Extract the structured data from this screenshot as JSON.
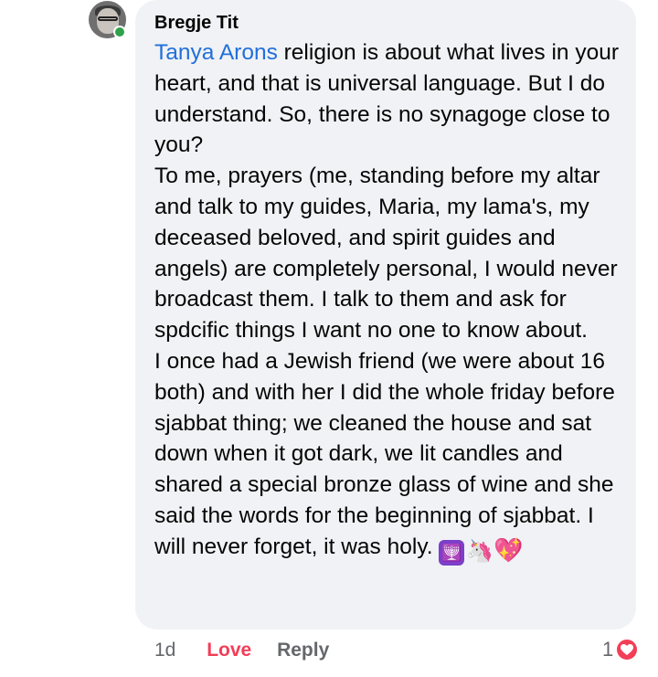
{
  "comment": {
    "author": "Bregje Tit",
    "mention": "Tanya Arons",
    "lines": [
      " religion is about what lives in your heart, and that is universal language. But I do understand. So, there is no synagoge close to you?",
      "To me, prayers (me, standing before my altar and talk to my guides, Maria, my lama's, my deceased beloved, and spirit guides and angels) are completely personal, I would never broadcast them. I talk to them and ask for spdcific things I want no one to know about.",
      "I once had a Jewish friend (we were about 16 both) and with her I did the whole friday before sjabbat thing; we cleaned the house and sat down when it got dark, we lit candles and shared a special bronze glass of wine and she said the words for the beginning of sjabbat. I will never forget, it was holy. "
    ],
    "emojis": [
      "menorah-emoji",
      "unicorn-emoji",
      "sparkling-heart-emoji"
    ],
    "colors": {
      "mention": "#216fdb",
      "love": "#f33e58",
      "bubble": "#f0f2f5",
      "online": "#31a24c"
    }
  },
  "actions": {
    "time": "1d",
    "love": "Love",
    "reply": "Reply"
  },
  "reactions": {
    "count": "1",
    "icon": "heart-reaction-icon"
  }
}
